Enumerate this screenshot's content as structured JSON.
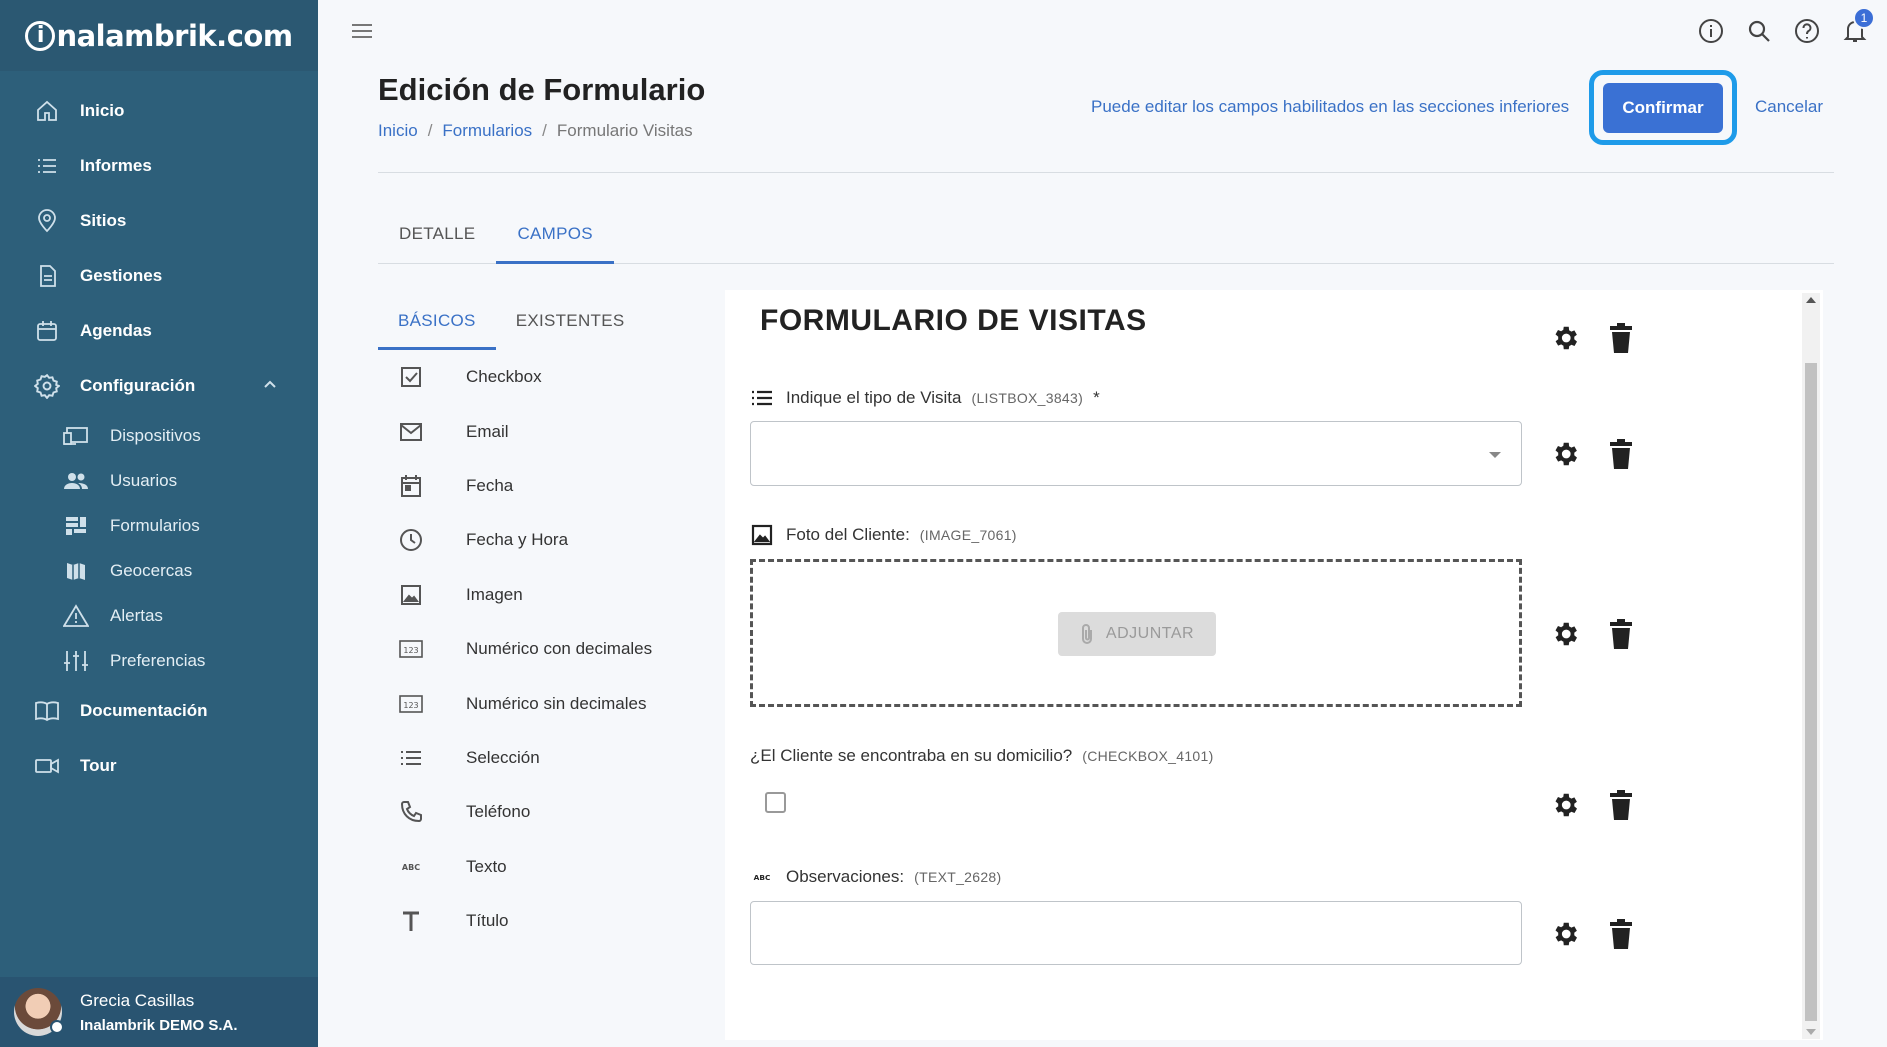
{
  "brand": {
    "logo_text": "nalambrik.com",
    "logo_initial": "i"
  },
  "sidebar": {
    "items": [
      {
        "label": "Inicio",
        "icon": "home-icon"
      },
      {
        "label": "Informes",
        "icon": "list-icon"
      },
      {
        "label": "Sitios",
        "icon": "location-pin-icon"
      },
      {
        "label": "Gestiones",
        "icon": "document-icon"
      },
      {
        "label": "Agendas",
        "icon": "calendar-icon"
      },
      {
        "label": "Configuración",
        "icon": "gear-icon",
        "expanded": true
      }
    ],
    "config_subitems": [
      {
        "label": "Dispositivos",
        "icon": "devices-icon"
      },
      {
        "label": "Usuarios",
        "icon": "users-icon"
      },
      {
        "label": "Formularios",
        "icon": "forms-icon"
      },
      {
        "label": "Geocercas",
        "icon": "map-icon"
      },
      {
        "label": "Alertas",
        "icon": "warning-icon"
      },
      {
        "label": "Preferencias",
        "icon": "sliders-icon"
      }
    ],
    "bottom_items": [
      {
        "label": "Documentación",
        "icon": "book-icon"
      },
      {
        "label": "Tour",
        "icon": "video-icon"
      }
    ],
    "user": {
      "name": "Grecia Casillas",
      "org": "Inalambrik DEMO S.A."
    }
  },
  "topbar": {
    "notification_count": "1"
  },
  "header": {
    "title": "Edición de Formulario",
    "breadcrumb": [
      "Inicio",
      "Formularios",
      "Formulario Visitas"
    ],
    "hint": "Puede editar los campos habilitados en las secciones inferiores",
    "confirm_label": "Confirmar",
    "cancel_label": "Cancelar"
  },
  "tabs": [
    "DETALLE",
    "CAMPOS"
  ],
  "active_tab": "CAMPOS",
  "subtabs": [
    "BÁSICOS",
    "EXISTENTES"
  ],
  "active_subtab": "BÁSICOS",
  "field_types": [
    {
      "label": "Checkbox",
      "icon": "checkbox-icon"
    },
    {
      "label": "Email",
      "icon": "email-icon"
    },
    {
      "label": "Fecha",
      "icon": "calendar-icon"
    },
    {
      "label": "Fecha y Hora",
      "icon": "clock-icon"
    },
    {
      "label": "Imagen",
      "icon": "image-icon"
    },
    {
      "label": "Numérico con decimales",
      "icon": "numeric-icon"
    },
    {
      "label": "Numérico sin decimales",
      "icon": "numeric-icon"
    },
    {
      "label": "Selección",
      "icon": "list-icon"
    },
    {
      "label": "Teléfono",
      "icon": "phone-icon"
    },
    {
      "label": "Texto",
      "icon": "abc-icon"
    },
    {
      "label": "Título",
      "icon": "title-icon"
    }
  ],
  "form": {
    "title": "FORMULARIO DE VISITAS",
    "fields": [
      {
        "label": "Indique el tipo de Visita",
        "code": "(LISTBOX_3843)",
        "required": "*",
        "type": "listbox"
      },
      {
        "label": "Foto del Cliente:",
        "code": "(IMAGE_7061)",
        "type": "image",
        "attach_label": "ADJUNTAR"
      },
      {
        "label": "¿El Cliente se encontraba en su domicilio?",
        "code": "(CHECKBOX_4101)",
        "type": "checkbox"
      },
      {
        "label": "Observaciones:",
        "code": "(TEXT_2628)",
        "type": "text"
      }
    ]
  },
  "colors": {
    "sidebar": "#2d5f7a",
    "accent": "#3a71c6",
    "confirm_outline": "#1e9be9"
  }
}
